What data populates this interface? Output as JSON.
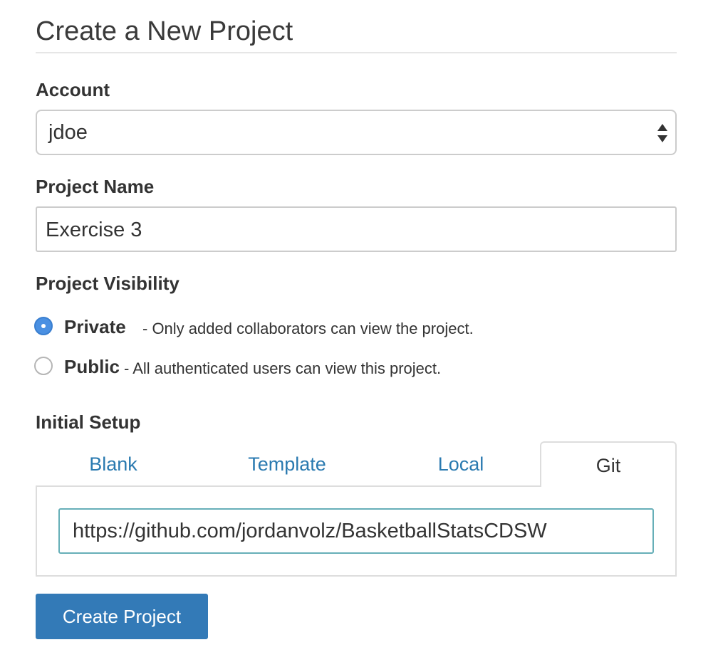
{
  "page": {
    "title": "Create a New Project"
  },
  "account": {
    "label": "Account",
    "selected": "jdoe"
  },
  "project_name": {
    "label": "Project Name",
    "value": "Exercise 3"
  },
  "visibility": {
    "label": "Project Visibility",
    "options": [
      {
        "name": "Private",
        "description": "- Only added collaborators can view the project.",
        "checked": true
      },
      {
        "name": "Public",
        "description": "- All authenticated users can view this project.",
        "checked": false
      }
    ]
  },
  "initial_setup": {
    "label": "Initial Setup",
    "tabs": [
      {
        "label": "Blank",
        "active": false
      },
      {
        "label": "Template",
        "active": false
      },
      {
        "label": "Local",
        "active": false
      },
      {
        "label": "Git",
        "active": true
      }
    ],
    "git_url": "https://github.com/jordanvolz/BasketballStatsCDSW"
  },
  "actions": {
    "create_label": "Create Project"
  },
  "colors": {
    "primary_button": "#337ab7",
    "tab_link": "#2a7ab0",
    "radio_checked": "#4a90e2",
    "focus_border": "#66afb8"
  }
}
